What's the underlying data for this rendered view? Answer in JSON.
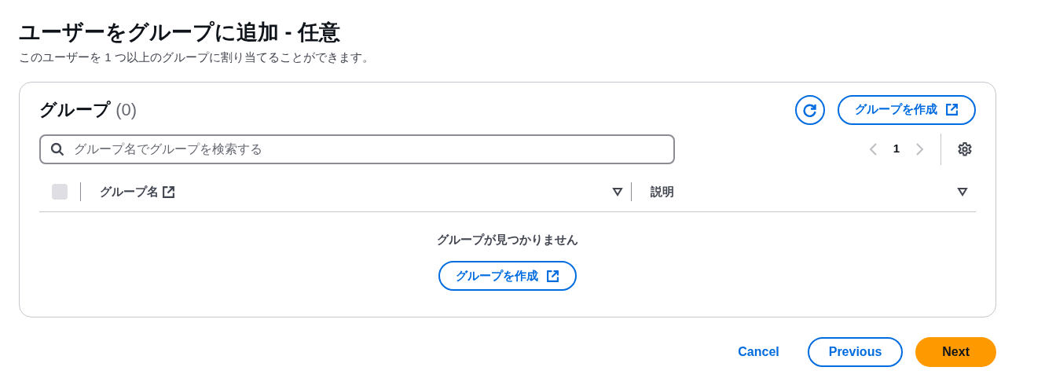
{
  "header": {
    "title": "ユーザーをグループに追加 - 任意",
    "description": "このユーザーを 1 つ以上のグループに割り当てることができます。"
  },
  "groups_panel": {
    "title": "グループ",
    "count": "(0)",
    "create_button": "グループを作成",
    "search": {
      "placeholder": "グループ名でグループを検索する"
    },
    "pagination": {
      "page": "1",
      "previous_disabled": true,
      "next_disabled": true
    },
    "select_all": {
      "checked": false,
      "disabled": true
    },
    "columns": [
      {
        "label": "グループ名",
        "external_link": true
      },
      {
        "label": "説明",
        "external_link": false
      }
    ],
    "empty_message": "グループが見つかりません",
    "empty_create_button": "グループを作成"
  },
  "footer_buttons": [
    {
      "label": "Cancel",
      "kind": "link"
    },
    {
      "label": "Previous",
      "kind": "secondary"
    },
    {
      "label": "Next",
      "kind": "primary"
    }
  ]
}
